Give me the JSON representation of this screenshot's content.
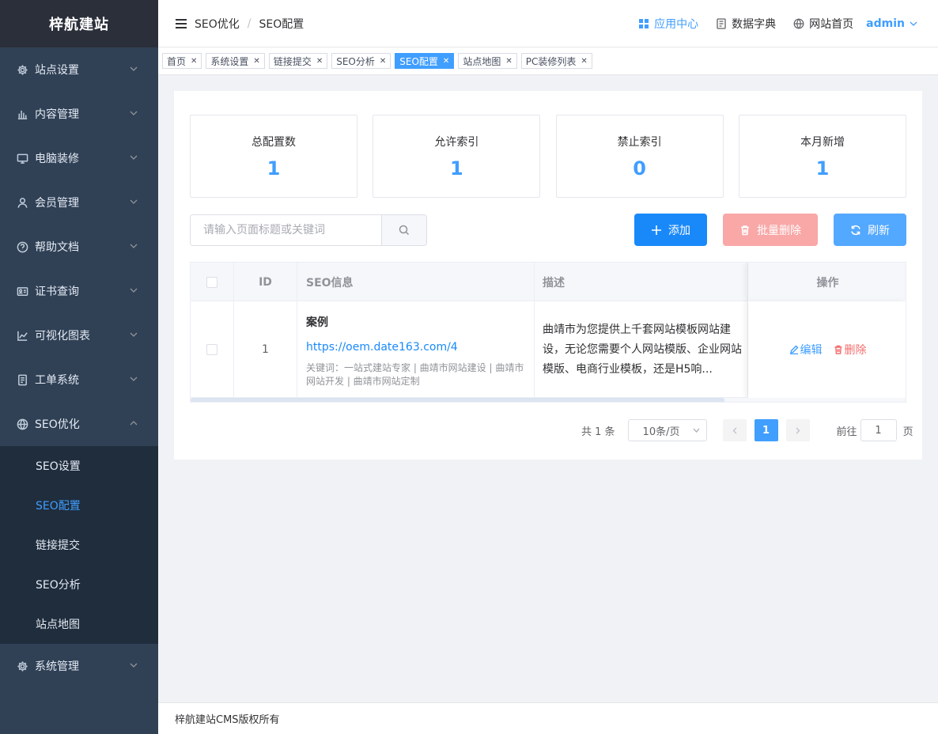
{
  "sidebar": {
    "logo": "梓航建站",
    "menu": [
      {
        "label": "站点设置",
        "icon": "gear-icon"
      },
      {
        "label": "内容管理",
        "icon": "bar-chart-icon"
      },
      {
        "label": "电脑装修",
        "icon": "monitor-icon"
      },
      {
        "label": "会员管理",
        "icon": "user-icon"
      },
      {
        "label": "帮助文档",
        "icon": "question-icon"
      },
      {
        "label": "证书查询",
        "icon": "id-card-icon"
      },
      {
        "label": "可视化图表",
        "icon": "line-chart-icon"
      },
      {
        "label": "工单系统",
        "icon": "document-icon"
      },
      {
        "label": "SEO优化",
        "icon": "globe-icon"
      }
    ],
    "submenu": [
      "SEO设置",
      "SEO配置",
      "链接提交",
      "SEO分析",
      "站点地图"
    ],
    "active_sub": "SEO配置",
    "system": {
      "label": "系统管理",
      "icon": "gear-icon"
    }
  },
  "header": {
    "breadcrumb": [
      "SEO优化",
      "SEO配置"
    ],
    "app_center": "应用中心",
    "dictionary": "数据字典",
    "home": "网站首页",
    "user": "admin"
  },
  "tags": [
    {
      "label": "首页",
      "active": false
    },
    {
      "label": "系统设置",
      "active": false
    },
    {
      "label": "链接提交",
      "active": false
    },
    {
      "label": "SEO分析",
      "active": false
    },
    {
      "label": "SEO配置",
      "active": true
    },
    {
      "label": "站点地图",
      "active": false
    },
    {
      "label": "PC装修列表",
      "active": false
    }
  ],
  "stats": [
    {
      "label": "总配置数",
      "value": "1"
    },
    {
      "label": "允许索引",
      "value": "1"
    },
    {
      "label": "禁止索引",
      "value": "0"
    },
    {
      "label": "本月新增",
      "value": "1"
    }
  ],
  "toolbar": {
    "search_placeholder": "请输入页面标题或关键词",
    "search_value": "",
    "add_label": "添加",
    "batch_delete_label": "批量删除",
    "refresh_label": "刷新"
  },
  "table": {
    "headers": {
      "id": "ID",
      "seo": "SEO信息",
      "desc": "描述",
      "op": "操作"
    },
    "rows": [
      {
        "id": "1",
        "title": "案例",
        "url": "https://oem.date163.com/4",
        "keywords": "关键词：一站式建站专家 | 曲靖市网站建设 | 曲靖市网站开发 | 曲靖市网站定制",
        "desc": "曲靖市为您提供上千套网站模板网站建设，无论您需要个人网站模版、企业网站模版、电商行业模板，还是H5响...",
        "edit": "编辑",
        "delete": "删除"
      }
    ],
    "scroll_fraction": 0.745
  },
  "pagination": {
    "total": "共 1 条",
    "page_size": "10条/页",
    "current": "1",
    "goto_label": "前往",
    "goto_value": "1",
    "page_suffix": "页"
  },
  "footer": "梓航建站CMS版权所有"
}
